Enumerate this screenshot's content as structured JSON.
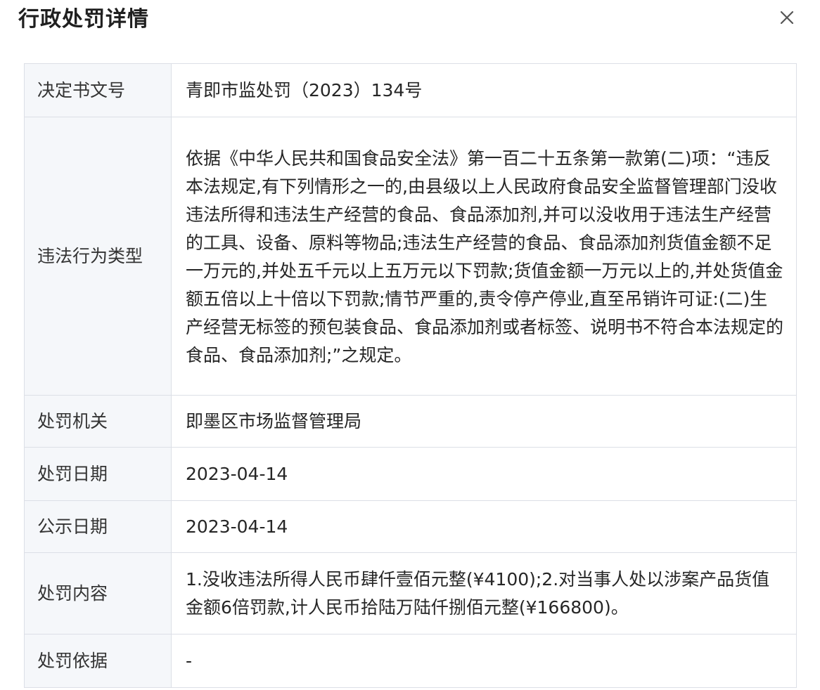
{
  "dialog": {
    "title": "行政处罚详情",
    "close_icon": "close-icon"
  },
  "details": {
    "rows": [
      {
        "label": "决定书文号",
        "value": "青即市监处罚（2023）134号"
      },
      {
        "label": "违法行为类型",
        "value": "依据《中华人民共和国食品安全法》第一百二十五条第一款第(二)项：“违反本法规定,有下列情形之一的,由县级以上人民政府食品安全监督管理部门没收违法所得和违法生产经营的食品、食品添加剂,并可以没收用于违法生产经营的工具、设备、原料等物品;违法生产经营的食品、食品添加剂货值金额不足一万元的,并处五千元以上五万元以下罚款;货值金额一万元以上的,并处货值金额五倍以上十倍以下罚款;情节严重的,责令停产停业,直至吊销许可证:(二)生产经营无标签的预包装食品、食品添加剂或者标签、说明书不符合本法规定的食品、食品添加剂;”之规定。"
      },
      {
        "label": "处罚机关",
        "value": "即墨区市场监督管理局"
      },
      {
        "label": "处罚日期",
        "value": "2023-04-14"
      },
      {
        "label": "公示日期",
        "value": "2023-04-14"
      },
      {
        "label": "处罚内容",
        "value": "1.没收违法所得人民币肆仟壹佰元整(¥4100);2.对当事人处以涉案产品货值金额6倍罚款,计人民币拾陆万陆仟捌佰元整(¥166800)。"
      },
      {
        "label": "处罚依据",
        "value": "-"
      }
    ]
  },
  "colors": {
    "border": "#dcdfe6",
    "label_background": "#f5f7fa",
    "text": "#262626"
  }
}
